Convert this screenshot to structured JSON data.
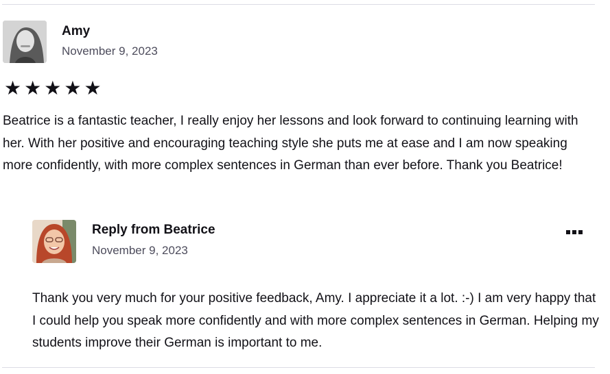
{
  "review": {
    "reviewer_name": "Amy",
    "date": "November 9, 2023",
    "rating": 5,
    "stars": [
      "★",
      "★",
      "★",
      "★",
      "★"
    ],
    "text": "Beatrice is a fantastic teacher, I really enjoy her lessons and look forward to continuing learning with her. With her positive and encouraging teaching style she puts me at ease and I am now speaking more confidently, with more complex sentences in German than ever before. Thank you Beatrice!"
  },
  "reply": {
    "title": "Reply from Beatrice",
    "date": "November 9, 2023",
    "more_icon": "ellipsis-icon",
    "text": "Thank you very much for your positive feedback, Amy. I appreciate it a lot. :-) I am very happy that I could help you speak more confidently and with more complex sentences in German. Helping my students improve their German is important to me."
  },
  "colors": {
    "text": "#121117",
    "muted": "#4d4c5c",
    "divider": "#dcdce5"
  }
}
